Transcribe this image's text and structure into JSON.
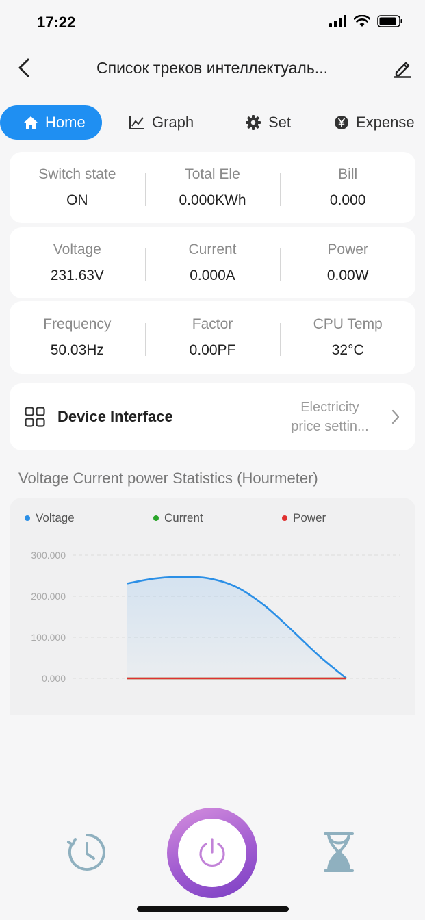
{
  "status": {
    "time": "17:22"
  },
  "nav": {
    "title": "Список треков интеллектуаль..."
  },
  "tabs": [
    {
      "label": "Home",
      "icon": "home-icon",
      "active": true
    },
    {
      "label": "Graph",
      "icon": "chart-line-icon",
      "active": false
    },
    {
      "label": "Set",
      "icon": "gear-icon",
      "active": false
    },
    {
      "label": "Expense",
      "icon": "yen-icon",
      "active": false
    }
  ],
  "stats": {
    "row1": [
      {
        "label": "Switch state",
        "value": "ON"
      },
      {
        "label": "Total Ele",
        "value": "0.000KWh"
      },
      {
        "label": "Bill",
        "value": "0.000"
      }
    ],
    "row2": [
      {
        "label": "Voltage",
        "value": "231.63V"
      },
      {
        "label": "Current",
        "value": "0.000A"
      },
      {
        "label": "Power",
        "value": "0.00W"
      }
    ],
    "row3": [
      {
        "label": "Frequency",
        "value": "50.03Hz"
      },
      {
        "label": "Factor",
        "value": "0.00PF"
      },
      {
        "label": "CPU Temp",
        "value": "32°C"
      }
    ]
  },
  "device": {
    "title": "Device Interface",
    "hint_line1": "Electricity",
    "hint_line2": "price settin..."
  },
  "section_title": "Voltage Current power Statistics (Hourmeter)",
  "colors": {
    "accent": "#1f8ff2",
    "voltage": "#2b8fe6",
    "current": "#2aa52a",
    "power": "#e03030"
  },
  "chart_data": {
    "type": "area",
    "title": "",
    "xlabel": "",
    "ylabel": "",
    "ylim": [
      0,
      300
    ],
    "yticks": [
      "300.000",
      "200.000",
      "100.000",
      "0.000"
    ],
    "ytick_values": [
      300,
      200,
      100,
      0
    ],
    "grid": true,
    "legend_placement": "top",
    "x": [
      0,
      1,
      2,
      3,
      4,
      5,
      6,
      7,
      8
    ],
    "series": [
      {
        "name": "Voltage",
        "color": "#2b8fe6",
        "values": [
          231,
          243,
          247,
          243,
          222,
          178,
          118,
          55,
          0
        ]
      },
      {
        "name": "Current",
        "color": "#2aa52a",
        "values": [
          0,
          0,
          0,
          0,
          0,
          0,
          0,
          0,
          0
        ]
      },
      {
        "name": "Power",
        "color": "#e03030",
        "values": [
          0,
          0,
          0,
          0,
          0,
          0,
          0,
          0,
          0
        ]
      }
    ]
  }
}
